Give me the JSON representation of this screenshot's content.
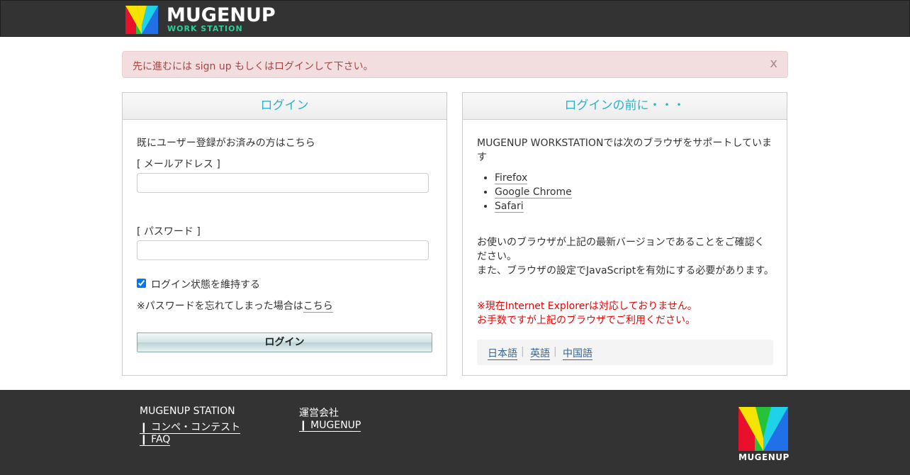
{
  "header": {
    "logo_text": "MUGENUP",
    "logo_sub": "WORK STATION"
  },
  "alert": {
    "message": "先に進むには sign up もしくはログインして下さい。",
    "close_label": "x"
  },
  "login_panel": {
    "title": "ログイン",
    "intro": "既にユーザー登録がお済みの方はこちら",
    "email_label": "[ メールアドレス ]",
    "email_value": "",
    "password_label": "[ パスワード ]",
    "password_value": "",
    "remember_label": "ログイン状態を維持する",
    "remember_checked": true,
    "forgot_text": "※パスワードを忘れてしまった場合は",
    "forgot_link": "こちら",
    "submit_label": "ログイン"
  },
  "info_panel": {
    "title": "ログインの前に・・・",
    "support_line1": "MUGENUP WORKSTATIONでは次のブラウザをサポートしていま",
    "support_line2": "す",
    "browsers": [
      "Firefox",
      "Google Chrome",
      "Safari"
    ],
    "note_line1": "お使いのブラウザが上記の最新バージョンであることをご確認く",
    "note_line2": "ださい。",
    "note_line3": "また、ブラウザの設定でJavaScriptを有効にする必要があります。",
    "warning_line1": "※現在Internet Explorerは対応しておりません。",
    "warning_line2": "お手数ですが上記のブラウザでご利用ください。",
    "languages": [
      "日本語",
      "英語",
      "中国語"
    ],
    "lang_separator": "|"
  },
  "footer": {
    "col1_title": "MUGENUP STATION",
    "col1_links": [
      "❙ コンペ・コンテスト",
      "❙ FAQ"
    ],
    "col2_title": "運営会社",
    "col2_links": [
      "❙ MUGENUP"
    ],
    "logo_text": "MUGENUP"
  },
  "colors": {
    "accent": "#2ab3c8",
    "alert_bg": "#f2dede",
    "alert_text": "#a94442",
    "warning": "#e00000",
    "dark": "#333333"
  }
}
